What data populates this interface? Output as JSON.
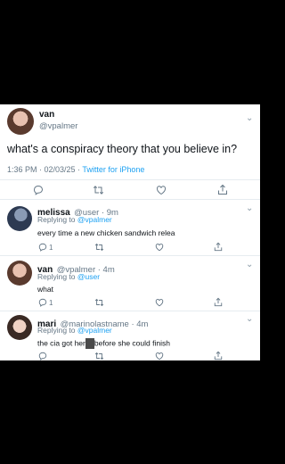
{
  "main_tweet": {
    "name": "van",
    "handle": "@vpalmer",
    "text": "what's a conspiracy theory that you believe in?",
    "time": "1:36 PM · 02/03/25 · ",
    "client": "Twitter for iPhone"
  },
  "replies": [
    {
      "name": "melissa",
      "handle_time": "@user · 9m",
      "replying_label": "Replying to ",
      "replying_to": "@vpalmer",
      "text": "every time a new chicken sandwich relea",
      "reply_count": "1"
    },
    {
      "name": "van",
      "handle_time": "@vpalmer · 4m",
      "replying_label": "Replying to ",
      "replying_to": "@user",
      "text": "what",
      "reply_count": "1"
    },
    {
      "name": "mari",
      "handle_time": "@marinolastname · 4m",
      "replying_label": "Replying to ",
      "replying_to": "@vpalmer",
      "text_before": "the cia got her",
      "text_after": "before she could finish"
    }
  ],
  "colors": {
    "link": "#1da1f2",
    "muted": "#657786",
    "text": "#0f1419"
  },
  "icons": [
    "chevron-down-icon",
    "reply-icon",
    "retweet-icon",
    "like-icon",
    "share-icon"
  ]
}
